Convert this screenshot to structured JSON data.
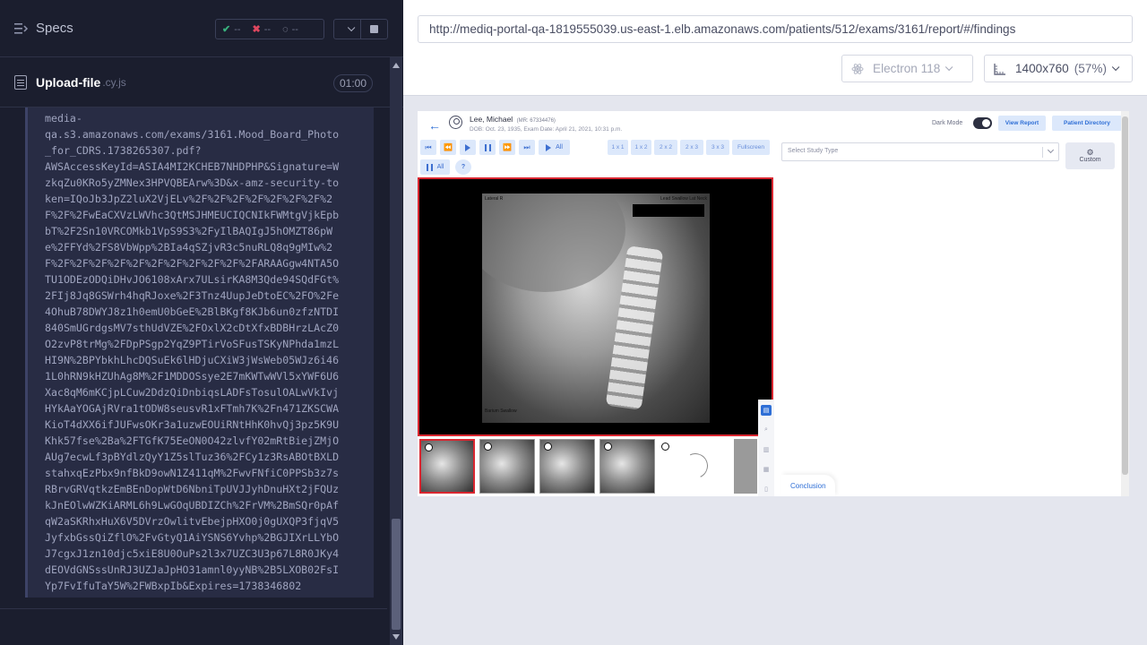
{
  "reporter": {
    "title": "Specs",
    "stats": {
      "passed": "--",
      "failed": "--",
      "pending": "--"
    },
    "spec": {
      "name": "Upload-file",
      "ext": ".cy.js",
      "time": "01:00"
    },
    "log_text": "media-\nqa.s3.amazonaws.com/exams/3161.Mood_Board_Photo_for_CDRS.1738265307.pdf?\nAWSAccessKeyId=ASIA4MI2KCHEB7NHDPHP&Signature=WzkqZu0KRo5yZMNex3HPVQBEArw%3D&x-amz-security-token=IQoJb3JpZ2luX2VjELv%2F%2F%2F%2F%2F%2F%2F%2F%2F%2FwEaCXVzLWVhc3QtMSJHMEUCIQCNIkFWMtgVjkEpbbT%2F2Sn10VRCOMkb1VpS9S3%2FyIlBAQIgJ5hOMZT86pWe%2FFYd%2FS8VbWpp%2BIa4qSZjvR3c5nuRLQ8q9gMIw%2F%2F%2F%2F%2F%2F%2F%2F%2F%2F%2F%2FARAAGgw4NTA5OTU1ODEzODQiDHvJO6108xArx7ULsirKA8M3Qde94SQdFGt%2FIj8Jq8GSWrh4hqRJoxe%2F3Tnz4UupJeDtoEC%2FO%2Fe4OhuB78DWYJ8z1h0emU0bGeE%2BlBKgf8KJb6un0zfzNTDI840SmUGrdgsMV7sthUdVZE%2FOxlX2cDtXfxBDBHrzLAcZ0O2zvP8trMg%2FDpPSgp2YqZ9PTirVoSFusTSKyNPhda1mzLHI9N%2BPYbkhLhcDQSuEk6lHDjuCXiW3jWsWeb05WJz6i461L0hRN9kHZUhAg8M%2F1MDDOSsye2E7mKWTwWVl5xYWF6U6Xac8qM6mKCjpLCuw2DdzQiDnbiqsLADFsTosulOALwVkIvjHYkAaYOGAjRVra1tODW8seusvR1xFTmh7K%2Fn471ZKSCWAKioT4dXX6ifJUFwsOKr3a1uzwEOUiRNtHhK0hvQj3pz5K9UKhk57fse%2Ba%2FTGfK75EeON0O42zlvfY02mRtBiejZMjOAUg7ecwLf3pBYdlzQyY1Z5slTuz36%2FCy1z3RsABOtBXLDstahxqEzPbx9nfBkD9owN1Z411qM%2FwvFNfiC0PPSb3z7sRBrvGRVqtkzEmBEnDopWtD6NbniTpUVJJyhDnuHXt2jFQUzkJnEOlwWZKiARML6h9LwGOqUBDIZCh%2FrVM%2BmSQr0pAfqW2aSKRhxHuX6V5DVrzOwlitvEbejpHXO0j0gUXQP3fjqV5JyfxbGssQiZflO%2FvGtyQ1AiYSNS6Yvhp%2BGJIXrLLYbOJ7cgxJ1zn10djc5xiE8U0OuPs2l3x7UZC3U3p67L8R0JKy4dEOVdGNSssUnRJ3UZJaJpHO31amnl0yyNB%2B5LXOB02FsIYp7FvIfuTaY5W%2FWBxpIb&Expires=1738346802"
  },
  "aut": {
    "url": "http://mediq-portal-qa-1819555039.us-east-1.elb.amazonaws.com/patients/512/exams/3161/report/#/findings",
    "browser": "Electron 118",
    "viewport": "1400x760",
    "scale": "(57%)"
  },
  "app": {
    "patient_name": "Lee, Michael",
    "patient_mr": "(MR: 67334476)",
    "patient_dob": "DOB: Oct. 23, 1935, Exam Date: April 21, 2021, 10:31 p.m.",
    "dark_mode_label": "Dark Mode",
    "view_report": "View Report",
    "patient_directory": "Patient Directory",
    "play_all": "All",
    "pause_all": "All",
    "help": "?",
    "grid": [
      "1 x 1",
      "1 x 2",
      "2 x 2",
      "2 x 3",
      "3 x 3"
    ],
    "fullscreen": "Fullscreen",
    "study_placeholder": "Select Study Type",
    "custom": "Custom",
    "conclusion": "Conclusion",
    "xray_labels": {
      "tl": "Lateral R",
      "tr": "Lead Swallow Lat Neck",
      "bl": "Barium Swallow"
    }
  },
  "colors": {
    "accent": "#2f6fd6",
    "selected_border": "#d92630"
  }
}
